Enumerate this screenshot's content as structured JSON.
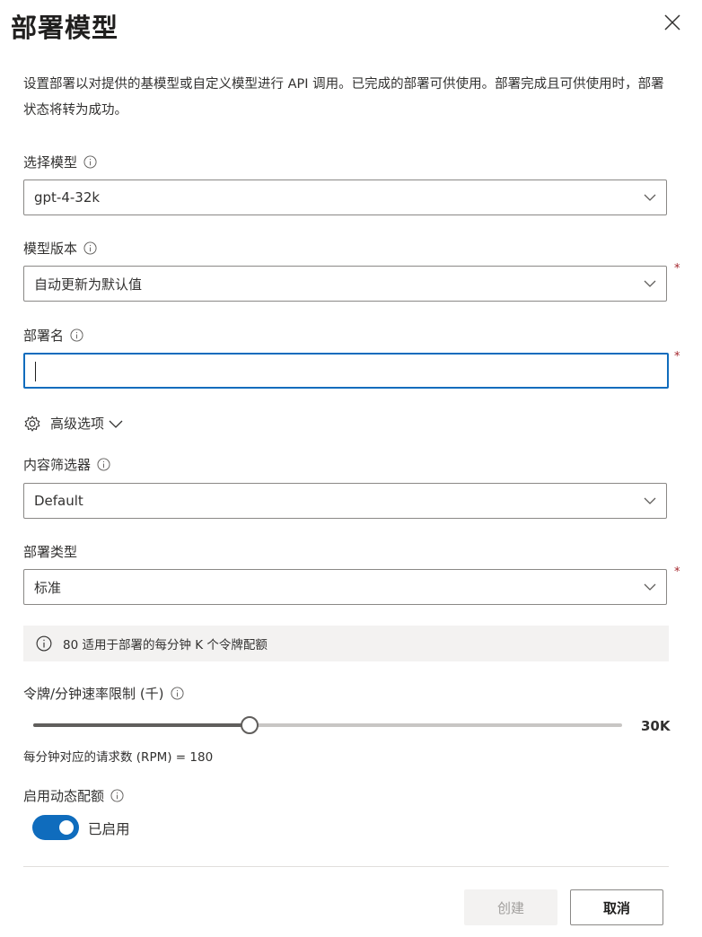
{
  "panel": {
    "title": "部署模型",
    "description": "设置部署以对提供的基模型或自定义模型进行 API 调用。已完成的部署可供使用。部署完成且可供使用时，部署状态将转为成功。"
  },
  "fields": {
    "model": {
      "label": "选择模型",
      "value": "gpt-4-32k"
    },
    "version": {
      "label": "模型版本",
      "value": "自动更新为默认值",
      "required_mark": "*"
    },
    "deployment_name": {
      "label": "部署名",
      "value": "",
      "required_mark": "*"
    },
    "advanced": {
      "label": "高级选项"
    },
    "content_filter": {
      "label": "内容筛选器",
      "value": "Default"
    },
    "deployment_type": {
      "label": "部署类型",
      "value": "标准",
      "required_mark": "*"
    }
  },
  "quota_info": {
    "text": "80 适用于部署的每分钟 K 个令牌配额"
  },
  "rate_limit": {
    "label": "令牌/分钟速率限制 (千)",
    "value_label": "30K",
    "fill_fraction": 0.37,
    "rpm_text": "每分钟对应的请求数 (RPM) = 180"
  },
  "dynamic_quota": {
    "label": "启用动态配额",
    "toggle_label": "已启用",
    "enabled": true
  },
  "buttons": {
    "create": "创建",
    "cancel": "取消"
  },
  "colors": {
    "accent": "#0f6cbd",
    "required": "#a4262c"
  },
  "icons": [
    "close-icon",
    "info-icon",
    "chevron-down-icon",
    "gear-icon"
  ]
}
